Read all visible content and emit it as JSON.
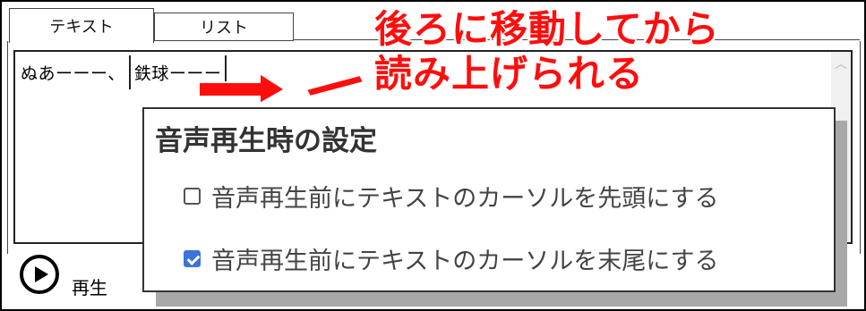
{
  "tabs": [
    {
      "label": "テキスト",
      "active": true
    },
    {
      "label": "リスト",
      "active": false
    }
  ],
  "editor": {
    "text": "ぬあーーー、鉄球ーーー",
    "text_before_caret": "ぬあーーー、",
    "text_after_caret": "鉄球ーーー"
  },
  "annotation": {
    "line1": "後ろに移動してから",
    "line2": "読み上げられる",
    "color": "#ff0d0d"
  },
  "playback": {
    "play_label": "再生"
  },
  "popup": {
    "title": "音声再生時の設定",
    "options": [
      {
        "label": "音声再生前にテキストのカーソルを先頭にする",
        "checked": false
      },
      {
        "label": "音声再生前にテキストのカーソルを末尾にする",
        "checked": true
      }
    ],
    "accent": "#3b73d9"
  }
}
